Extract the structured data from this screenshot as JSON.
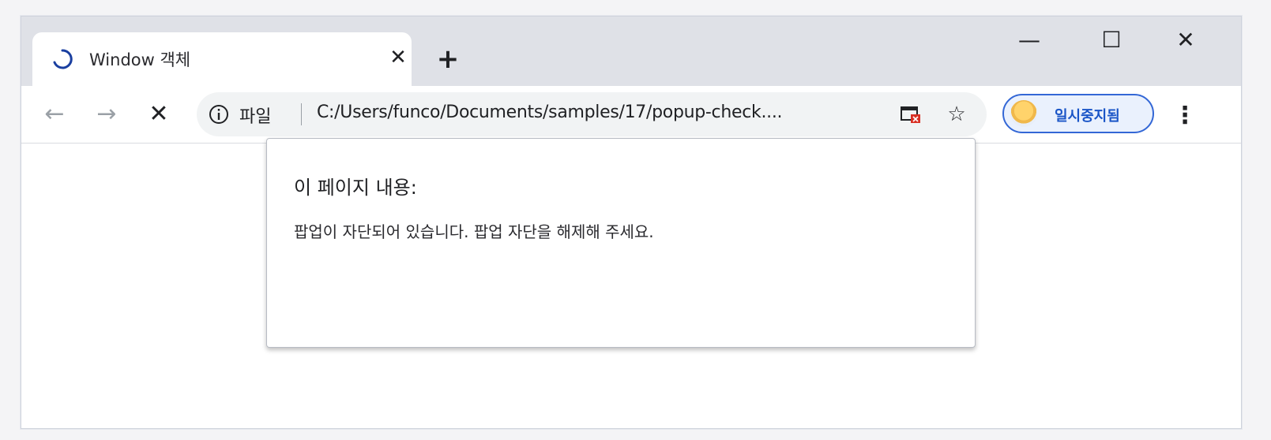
{
  "colors": {
    "titlebar_bg": "#dfe1e7",
    "tab_bg": "#ffffff",
    "accent": "#3367d6",
    "spinner": "#1a3fa0"
  },
  "tab": {
    "title": "Window 객체",
    "spinner_icon": "loading-spinner-icon",
    "close_label": "✕"
  },
  "new_tab_label": "+",
  "window_controls": {
    "minimize_label": "—",
    "maximize_label": "☐",
    "close_label": "✕"
  },
  "toolbar": {
    "back_label": "←",
    "forward_label": "→",
    "stop_label": "✕",
    "site_label": "파일",
    "url": "C:/Users/funco/Documents/samples/17/popup-check....",
    "bookmark_label": "☆",
    "popup_blocked_icon": "popup-blocked-icon",
    "profile_label": "일시중지됨",
    "menu_label": "⋮"
  },
  "dialog": {
    "title": "이 페이지 내용:",
    "message": "팝업이 자단되어 있습니다. 팝업 자단을 해제해 주세요."
  }
}
